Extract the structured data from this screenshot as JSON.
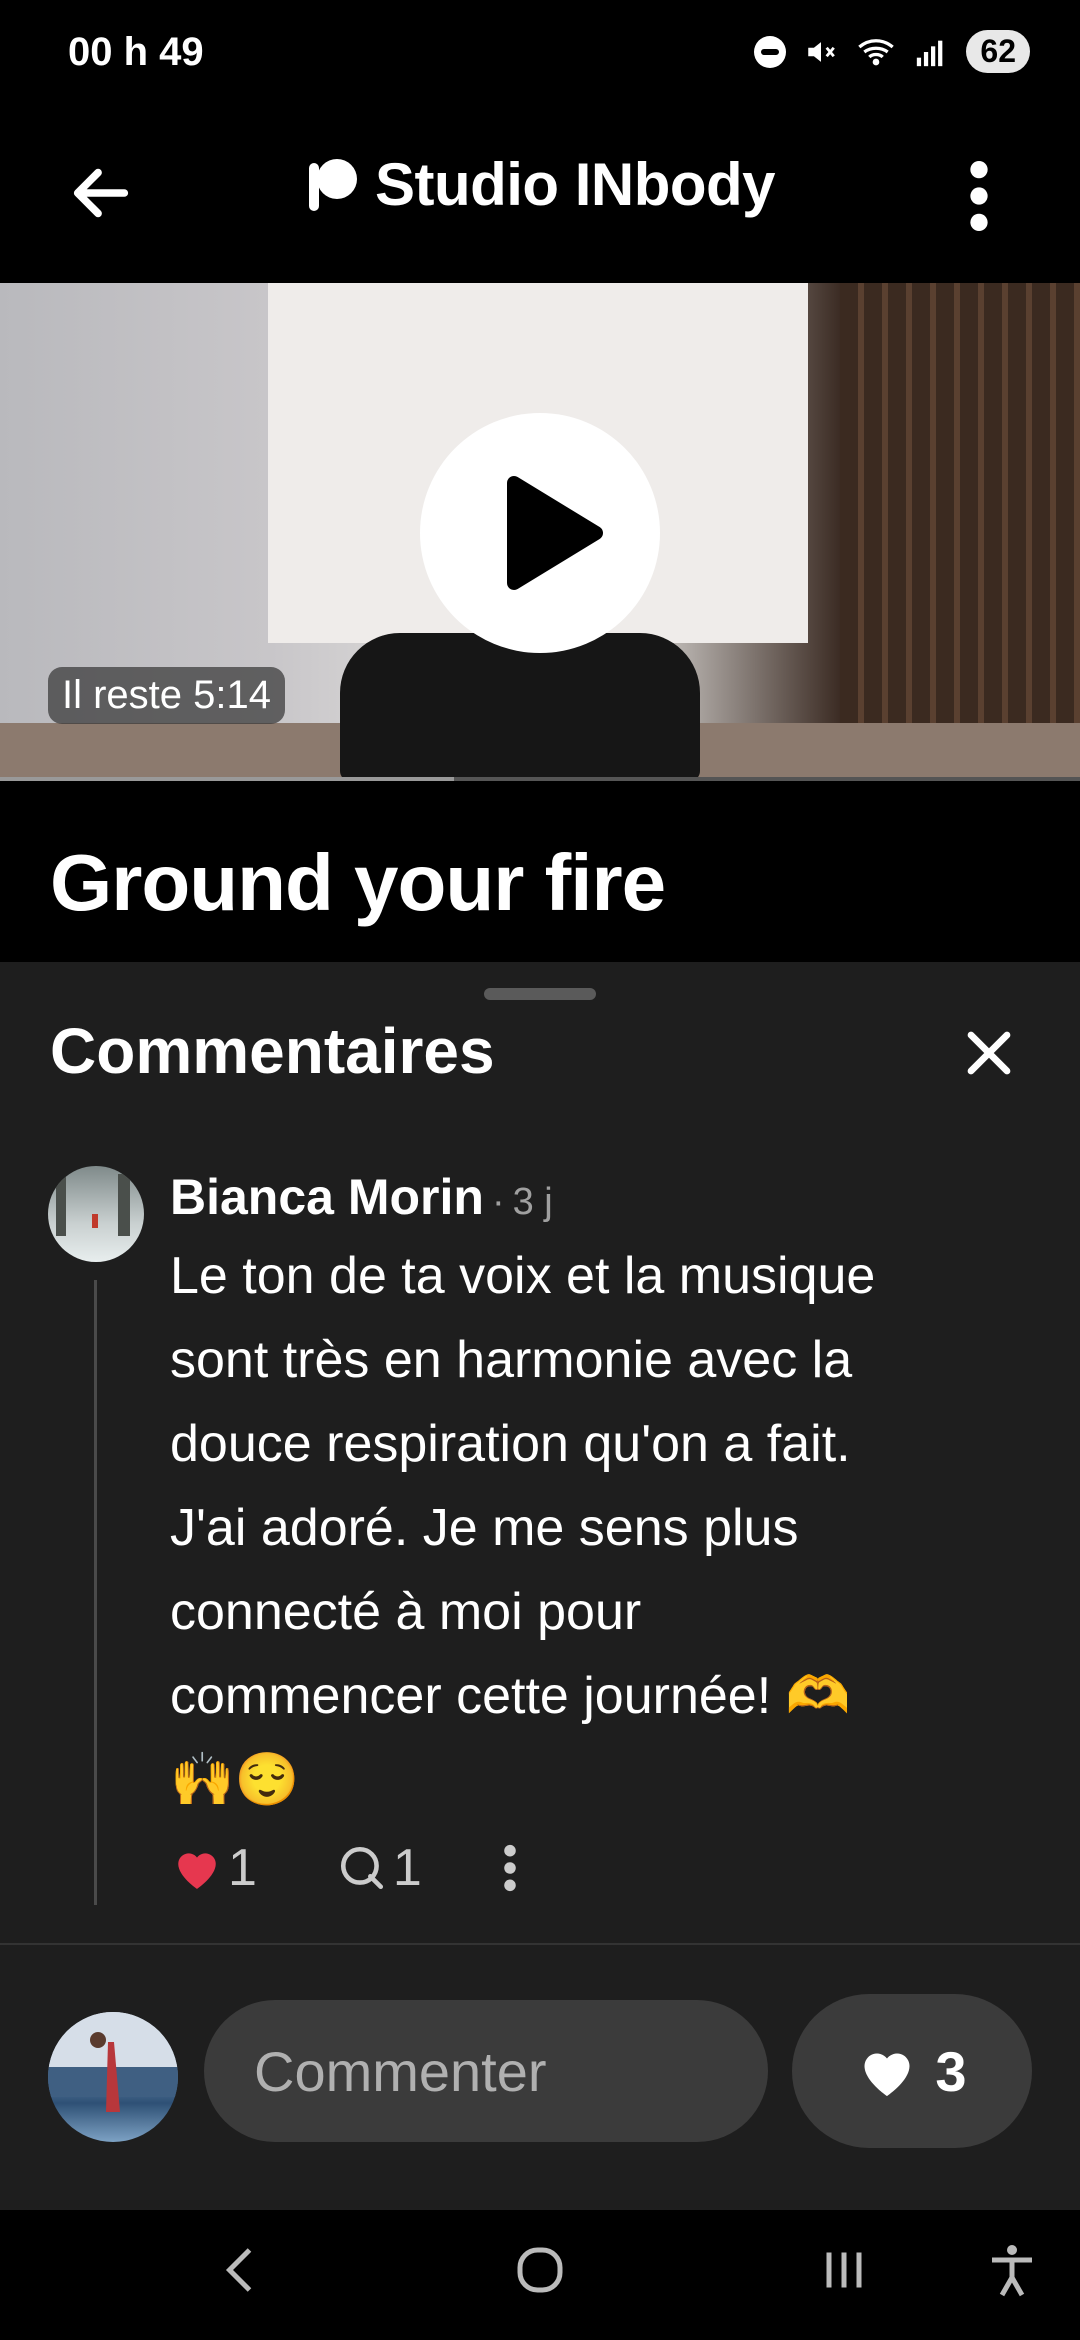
{
  "status": {
    "time": "00 h 49",
    "battery": "62"
  },
  "appbar": {
    "title": "Studio INbody"
  },
  "video": {
    "time_left": "Il reste 5:14",
    "progress": 0.42
  },
  "content": {
    "title": "Ground your fire"
  },
  "comments": {
    "heading": "Commentaires",
    "items": [
      {
        "author": "Bianca Morin",
        "separator": "·",
        "time": "3 j",
        "text_lines": [
          "Le ton de ta voix et la musique",
          "sont très en harmonie avec la",
          "douce respiration qu'on a fait.",
          "J'ai adoré. Je me sens plus",
          "connecté à moi pour",
          "commencer cette journée! 🫶",
          "🙌😌"
        ],
        "likes": "1",
        "replies": "1"
      }
    ]
  },
  "composer": {
    "placeholder": "Commenter",
    "like_count": "3"
  },
  "colors": {
    "heart": "#e6374f",
    "sheet_bg": "#1e1e1e",
    "pill_bg": "#3b3b3b"
  },
  "icons": [
    "back-arrow-icon",
    "patreon-logo-icon",
    "more-vertical-icon",
    "play-icon",
    "close-icon",
    "heart-icon",
    "comment-icon",
    "nav-back-icon",
    "nav-home-icon",
    "nav-recents-icon",
    "accessibility-icon"
  ]
}
